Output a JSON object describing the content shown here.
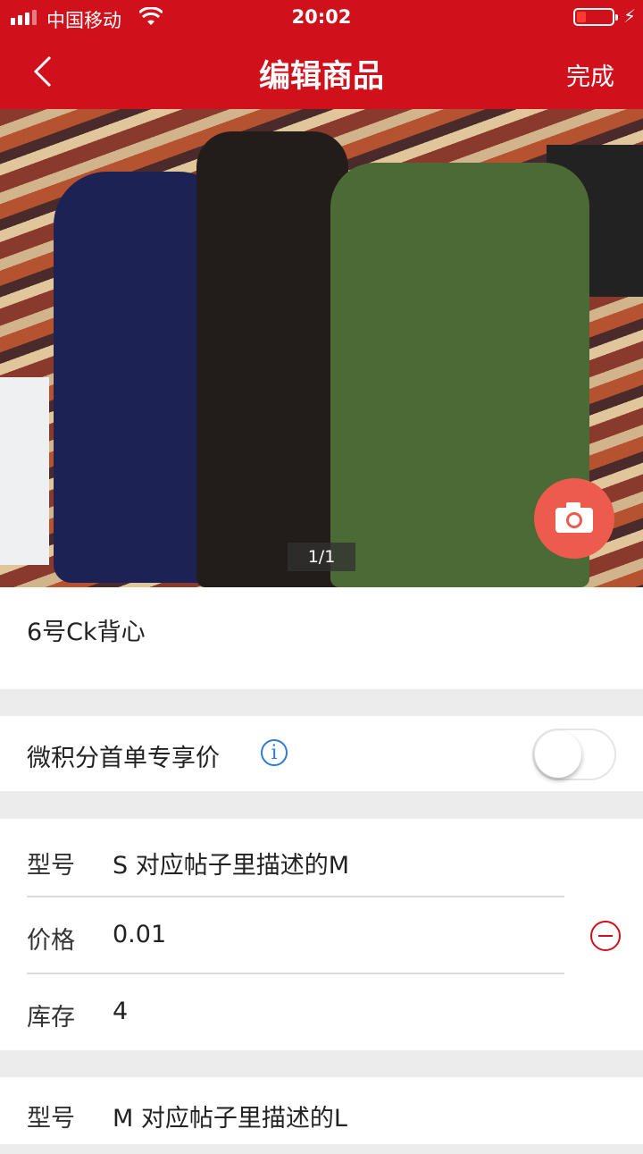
{
  "status_bar": {
    "carrier": "中国移动",
    "time": "20:02"
  },
  "nav": {
    "title": "编辑商品",
    "done_label": "完成"
  },
  "photo": {
    "counter": "1/1"
  },
  "product": {
    "name": "6号Ck背心"
  },
  "promo": {
    "label": "微积分首单专享价",
    "info_glyph": "i",
    "toggle_on": false
  },
  "variants": [
    {
      "model_label": "型号",
      "model_value": "S 对应帖子里描述的M",
      "price_label": "价格",
      "price_value": "0.01",
      "stock_label": "库存",
      "stock_value": "4"
    },
    {
      "model_label": "型号",
      "model_value": "M 对应帖子里描述的L"
    }
  ],
  "colors": {
    "accent": "#d0111b",
    "camera": "#ec5b4d",
    "info": "#2f7bd6"
  }
}
